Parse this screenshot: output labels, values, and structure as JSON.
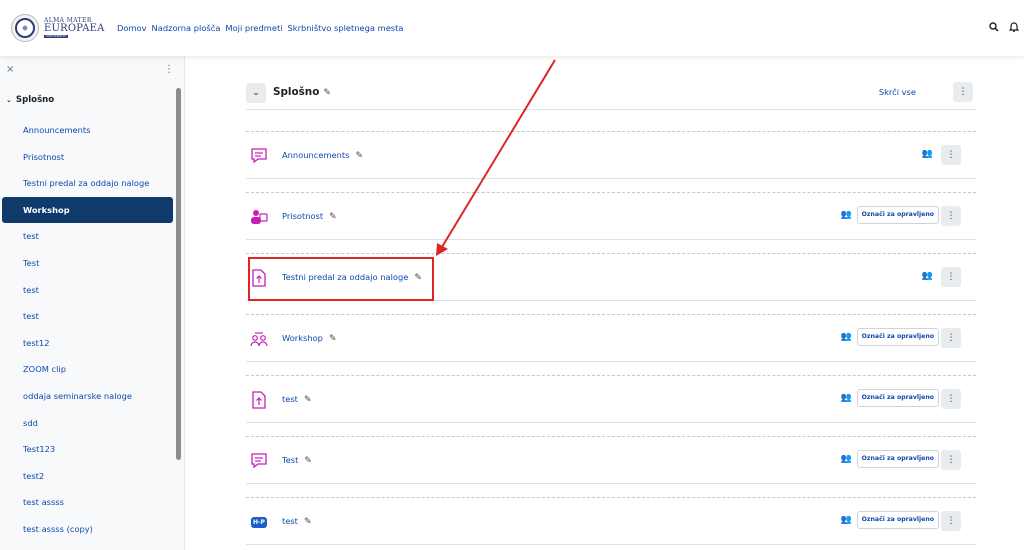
{
  "logo": {
    "line1": "ALMA MATER",
    "line2": "EUROPAEA",
    "line3": "UNIVERSITY"
  },
  "nav": [
    "Domov",
    "Nadzorna plošča",
    "Moji predmeti",
    "Skrbništvo spletnega mesta"
  ],
  "nav_icons": [
    "search-icon",
    "bell-icon"
  ],
  "drawer": {
    "close_glyph": "×",
    "kebab_glyph": "⋮",
    "section_title": "Splošno",
    "items": [
      "Announcements",
      "Prisotnost",
      "Testni predal za oddajo naloge",
      "Workshop",
      "test",
      "Test",
      "test",
      "test",
      "test12",
      "ZOOM clip",
      "oddaja seminarske naloge",
      "sdd",
      "Test123",
      "test2",
      "test assss",
      "test assss (copy)"
    ],
    "active_index": 3
  },
  "section": {
    "title": "Splošno",
    "hide_all": "Skrči vse"
  },
  "activities": [
    {
      "name": "Announcements",
      "icon": "forum-icon",
      "done_label": ""
    },
    {
      "name": "Prisotnost",
      "icon": "attendance-icon",
      "done_label": "Označi za opravljeno"
    },
    {
      "name": "Testni predal za oddajo naloge",
      "icon": "assignment-icon",
      "done_label": ""
    },
    {
      "name": "Workshop",
      "icon": "workshop-icon",
      "done_label": "Označi za opravljeno"
    },
    {
      "name": "test",
      "icon": "assignment-icon",
      "done_label": "Označi za opravljeno"
    },
    {
      "name": "Test",
      "icon": "forum-icon",
      "done_label": "Označi za opravljeno"
    },
    {
      "name": "test",
      "icon": "h5p-icon",
      "done_label": "Označi za opravljeno"
    }
  ],
  "colors": {
    "accent": "#0f47ad",
    "active_bg": "#0f3a69",
    "annotation": "#e02323",
    "activity_icon": "#c71fb6"
  },
  "h5p_label": "H-P"
}
